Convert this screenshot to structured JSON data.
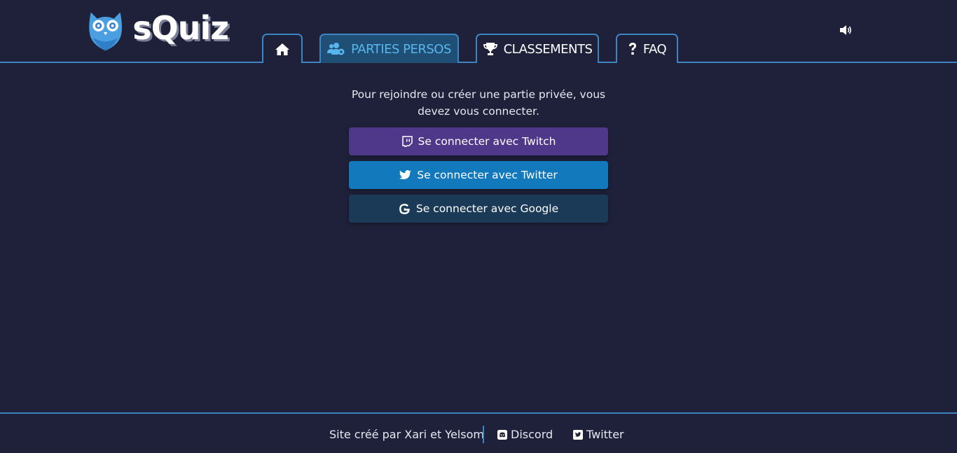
{
  "brand": {
    "name": "sQuiz",
    "logo_icon": "owl-logo"
  },
  "nav": {
    "tabs": [
      {
        "icon": "home-icon",
        "label": ""
      },
      {
        "icon": "users-cog-icon",
        "label": "PARTIES PERSOS",
        "active": true
      },
      {
        "icon": "trophy-icon",
        "label": "CLASSEMENTS"
      },
      {
        "icon": "question-icon",
        "label": "FAQ"
      }
    ],
    "sound_icon": "volume-icon"
  },
  "main": {
    "intro": "Pour rejoindre ou créer une partie privée, vous devez vous connecter.",
    "login_buttons": [
      {
        "label": "Se connecter avec Twitch",
        "icon": "twitch-icon",
        "color": "#4f3789"
      },
      {
        "label": "Se connecter avec Twitter",
        "icon": "twitter-icon",
        "color": "#1379bd"
      },
      {
        "label": "Se connecter avec Google",
        "icon": "google-icon",
        "color": "#1b3a58"
      }
    ]
  },
  "footer": {
    "credit": "Site créé par Xari et Yelsom",
    "links": [
      {
        "label": "Discord",
        "icon": "discord-icon"
      },
      {
        "label": "Twitter",
        "icon": "twitter-square-icon"
      }
    ]
  },
  "colors": {
    "background": "#1e2139",
    "accent": "#3d85c0",
    "active_tab": "#1f4f75",
    "active_text": "#57b6ee"
  }
}
